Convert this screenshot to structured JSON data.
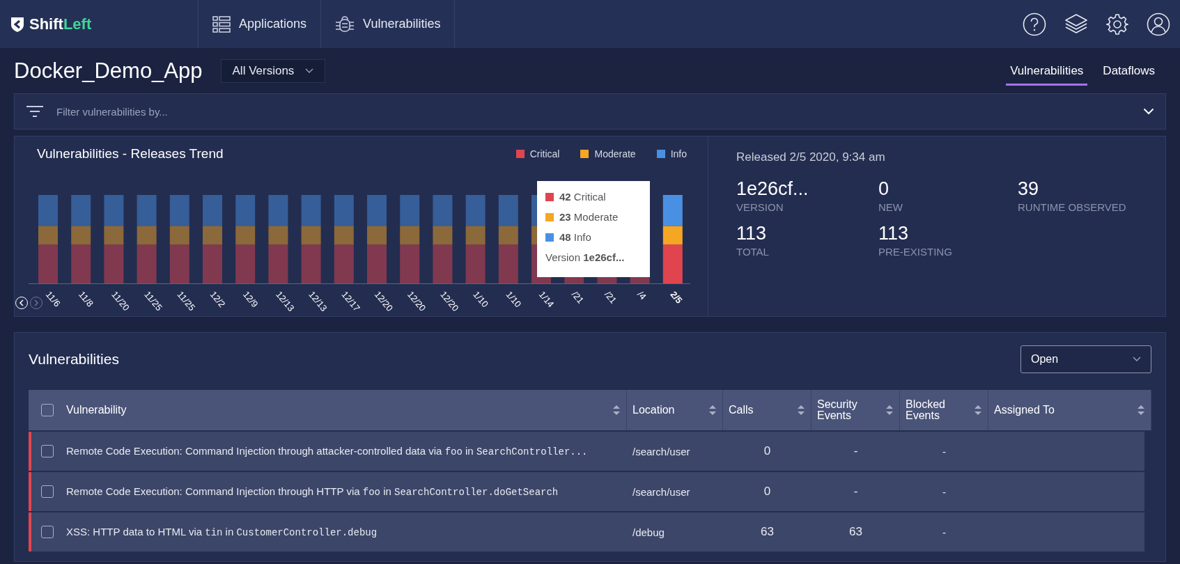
{
  "brand": {
    "name_start": "Shift",
    "name_end": "Left"
  },
  "nav": [
    {
      "label": "Applications",
      "kind": "list"
    },
    {
      "label": "Vulnerabilities",
      "kind": "bug"
    }
  ],
  "toolbar_icons": [
    {
      "kind": "help"
    },
    {
      "kind": "layers"
    },
    {
      "kind": "settings"
    },
    {
      "kind": "user"
    }
  ],
  "app": {
    "title": "Docker_Demo_App",
    "version_select": "All Versions"
  },
  "view_tabs": [
    {
      "label": "Vulnerabilities",
      "selected": true
    },
    {
      "label": "Dataflows",
      "selected": false
    }
  ],
  "filter": {
    "placeholder": "Filter vulnerabilities by..."
  },
  "trend": {
    "title": "Vulnerabilities - Releases Trend",
    "legend": [
      {
        "label": "Critical",
        "color": "#e0454f"
      },
      {
        "label": "Moderate",
        "color": "#f5a623"
      },
      {
        "label": "Info",
        "color": "#4a90e2"
      }
    ],
    "releases": [
      {
        "label": "11/6",
        "selected": false
      },
      {
        "label": "11/8",
        "selected": false
      },
      {
        "label": "11/20",
        "selected": false
      },
      {
        "label": "11/25",
        "selected": false
      },
      {
        "label": "11/25",
        "selected": false
      },
      {
        "label": "12/2",
        "selected": false
      },
      {
        "label": "12/9",
        "selected": false
      },
      {
        "label": "12/13",
        "selected": false
      },
      {
        "label": "12/13",
        "selected": false
      },
      {
        "label": "12/17",
        "selected": false
      },
      {
        "label": "12/20",
        "selected": false
      },
      {
        "label": "12/20",
        "selected": false
      },
      {
        "label": "12/20",
        "selected": false
      },
      {
        "label": "1/10",
        "selected": false
      },
      {
        "label": "1/10",
        "selected": false
      },
      {
        "label": "1/14",
        "selected": false
      },
      {
        "label": "/21",
        "selected": false
      },
      {
        "label": "/21",
        "selected": false
      },
      {
        "label": "/4",
        "selected": false
      },
      {
        "label": "2/5",
        "selected": true
      }
    ],
    "tooltip": {
      "lines": [
        {
          "text": "**42** Critical",
          "color": "#e0454f"
        },
        {
          "text": "**23** Moderate",
          "color": "#f5a623"
        },
        {
          "text": "**48** Info",
          "color": "#4a90e2"
        }
      ],
      "version": "Version **1e26cf...**"
    }
  },
  "release": {
    "released": "Released 2/5 2020, 9:34 am",
    "stats": [
      {
        "value": "1e26cf...",
        "label": "VERSION"
      },
      {
        "value": "0",
        "label": "NEW"
      },
      {
        "value": "39",
        "label": "RUNTIME OBSERVED"
      },
      {
        "value": "113",
        "label": "TOTAL"
      },
      {
        "value": "113",
        "label": "PRE-EXISTING"
      }
    ]
  },
  "vulnerabilities": {
    "title": "Vulnerabilities",
    "status_select": "Open",
    "header_checked": false,
    "columns": [
      "Vulnerability",
      "Location",
      "Calls",
      "Security Events",
      "Blocked Events",
      "Assigned To"
    ],
    "rows": [
      {
        "checked": false,
        "color": "#e0454f",
        "title": [
          {
            "kind": "text",
            "text": "Remote Code Execution: Command Injection through attacker-controlled data via "
          },
          {
            "kind": "code",
            "text": "foo"
          },
          {
            "kind": "text",
            "text": " in "
          },
          {
            "kind": "code",
            "text": "SearchController..."
          }
        ],
        "location": "/search/user",
        "calls": "0",
        "security_events": "-",
        "blocked_events": "-"
      },
      {
        "checked": false,
        "color": "#e0454f",
        "title": [
          {
            "kind": "text",
            "text": "Remote Code Execution: Command Injection through HTTP via "
          },
          {
            "kind": "code",
            "text": "foo"
          },
          {
            "kind": "text",
            "text": " in "
          },
          {
            "kind": "code",
            "text": "SearchController.doGetSearch"
          }
        ],
        "location": "/search/user",
        "calls": "0",
        "security_events": "-",
        "blocked_events": "-"
      },
      {
        "checked": false,
        "color": "#e0454f",
        "title": [
          {
            "kind": "text",
            "text": "XSS: HTTP data to HTML via "
          },
          {
            "kind": "code",
            "text": "tin"
          },
          {
            "kind": "text",
            "text": " in "
          },
          {
            "kind": "code",
            "text": "CustomerController.debug"
          }
        ],
        "location": "/debug",
        "calls": "63",
        "security_events": "63",
        "blocked_events": "-"
      }
    ]
  }
}
